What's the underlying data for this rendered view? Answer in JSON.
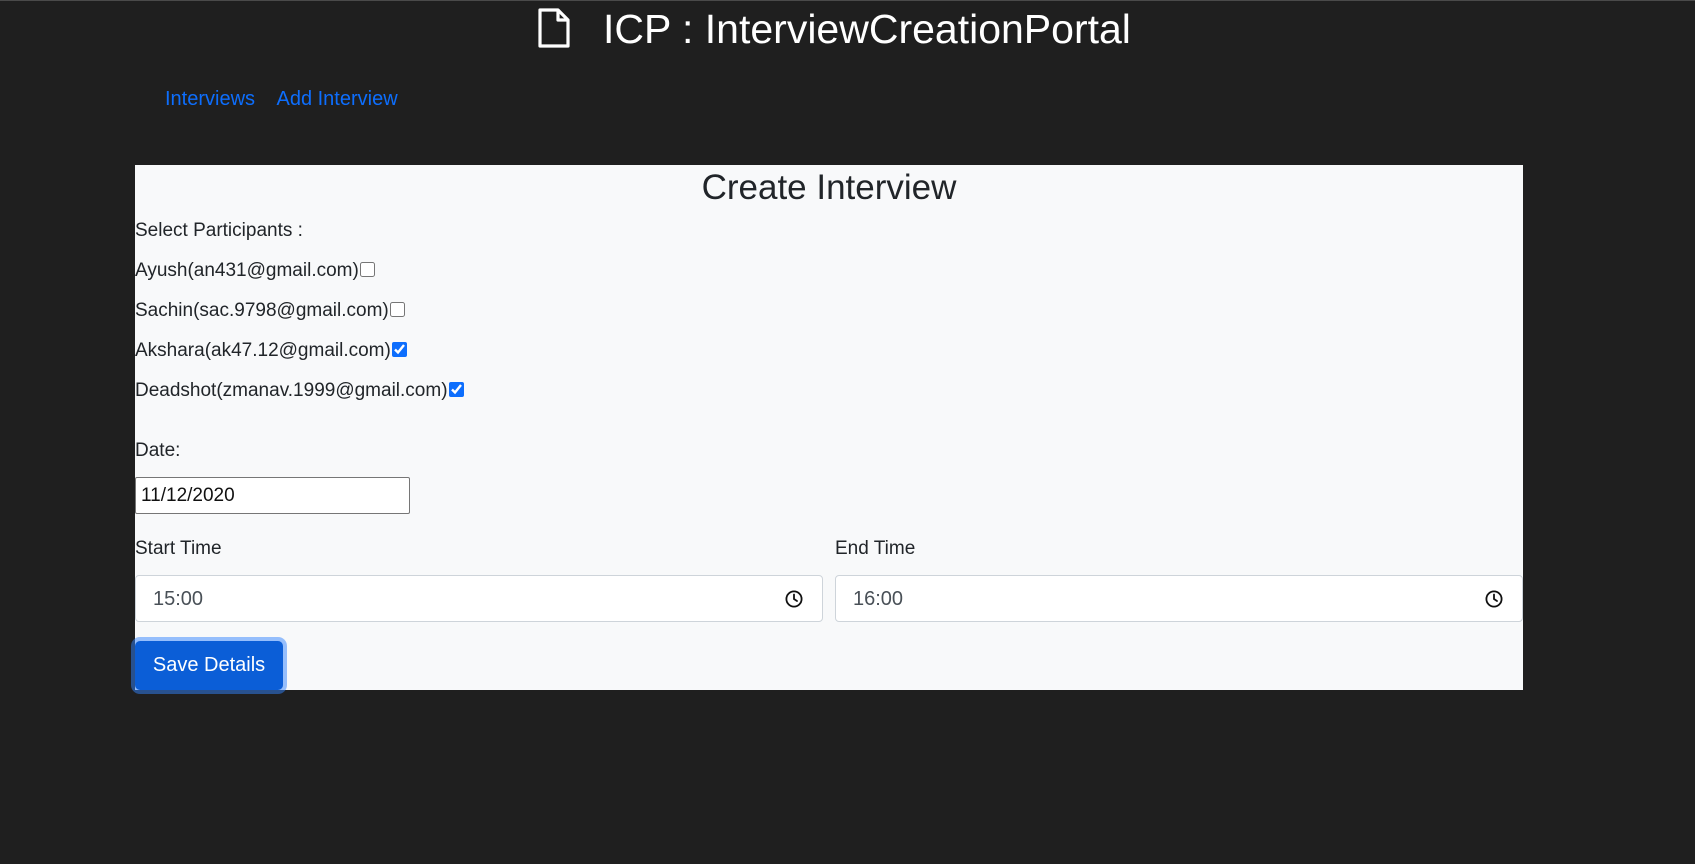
{
  "header": {
    "logo_icon": "file-icon",
    "title": "ICP : InterviewCreationPortal"
  },
  "nav": {
    "items": [
      {
        "label": "Interviews"
      },
      {
        "label": "Add Interview"
      }
    ],
    "link_color": "#0d6efd"
  },
  "form": {
    "title": "Create Interview",
    "participants_label": "Select Participants :",
    "participants": [
      {
        "label": "Ayush(an431@gmail.com)",
        "checked": false
      },
      {
        "label": "Sachin(sac.9798@gmail.com)",
        "checked": false
      },
      {
        "label": "Akshara(ak47.12@gmail.com)",
        "checked": true
      },
      {
        "label": "Deadshot(zmanav.1999@gmail.com)",
        "checked": true
      }
    ],
    "date_label": "Date:",
    "date_value": "11/12/2020",
    "start_time_label": "Start Time",
    "start_time_value": "15:00",
    "end_time_label": "End Time",
    "end_time_value": "16:00",
    "clock_icon": "clock-icon",
    "save_label": "Save Details"
  },
  "colors": {
    "background": "#1f1f1f",
    "panel": "#f8f9fa",
    "button": "#0b5ed7"
  }
}
